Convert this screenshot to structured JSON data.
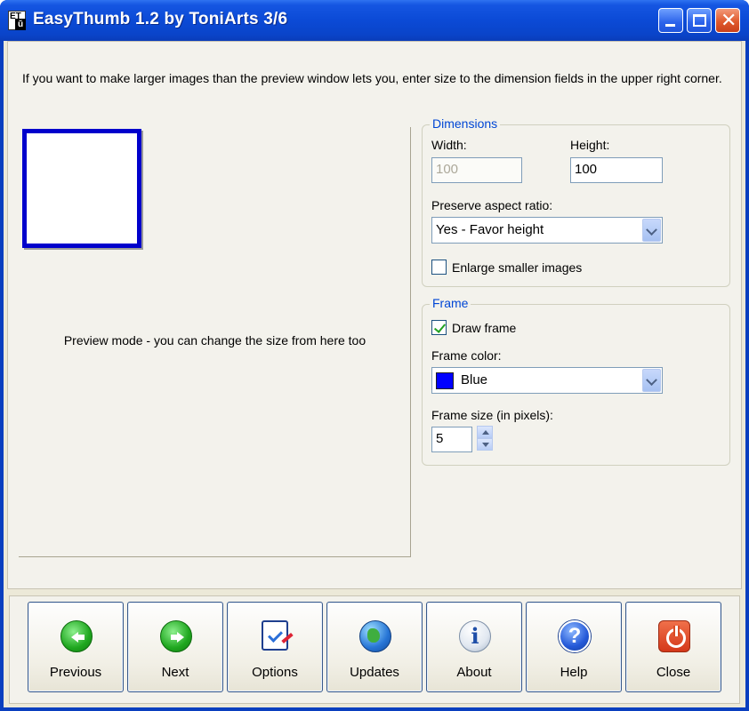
{
  "window": {
    "title": "EasyThumb 1.2 by ToniArts 3/6",
    "icon_text_top": "ET",
    "icon_text_bottom": "ŭ"
  },
  "info": {
    "text": "If you want to make larger images than the preview window lets you, enter size to the dimension fields in the upper right corner."
  },
  "preview": {
    "text": "Preview mode - you can change the size from here too",
    "frame_color": "#0000cc"
  },
  "dimensions": {
    "title": "Dimensions",
    "width_label": "Width:",
    "width_value": "100",
    "height_label": "Height:",
    "height_value": "100",
    "aspect_label": "Preserve aspect ratio:",
    "aspect_value": "Yes - Favor height",
    "enlarge_label": "Enlarge smaller images",
    "enlarge_checked": false
  },
  "frame": {
    "title": "Frame",
    "draw_label": "Draw frame",
    "draw_checked": true,
    "color_label": "Frame color:",
    "color_value": "Blue",
    "color_hex": "#0000ff",
    "size_label": "Frame size (in pixels):",
    "size_value": "5"
  },
  "buttons": [
    {
      "label": "Previous",
      "icon": "arrow-left-icon"
    },
    {
      "label": "Next",
      "icon": "arrow-right-icon"
    },
    {
      "label": "Options",
      "icon": "options-icon"
    },
    {
      "label": "Updates",
      "icon": "globe-icon"
    },
    {
      "label": "About",
      "icon": "info-icon"
    },
    {
      "label": "Help",
      "icon": "help-icon"
    },
    {
      "label": "Close",
      "icon": "power-icon"
    }
  ]
}
